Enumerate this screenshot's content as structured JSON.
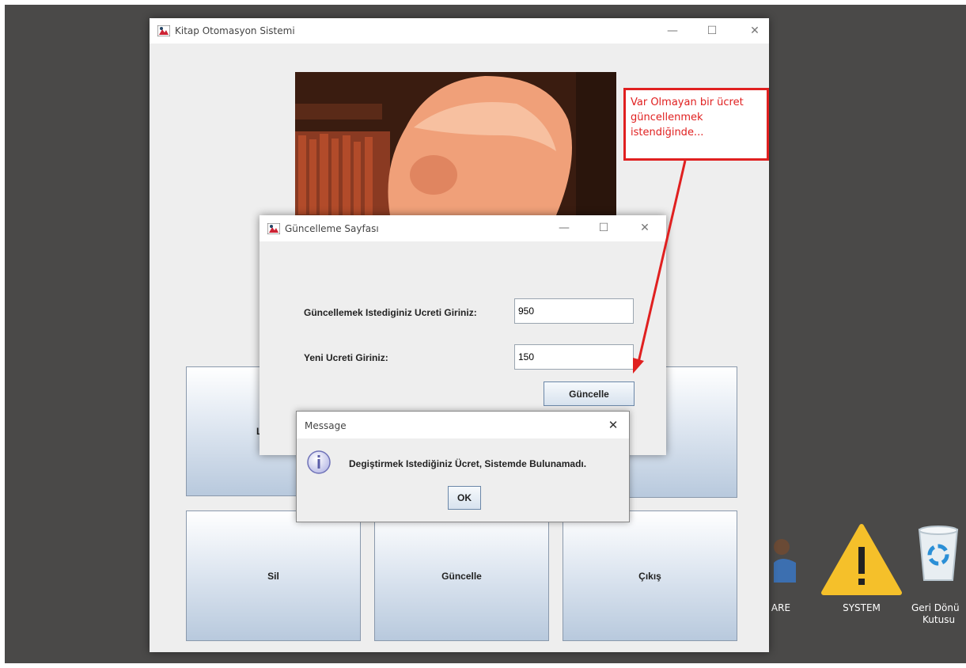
{
  "main_window": {
    "title": "Kitap Otomasyon Sistemi",
    "buttons": {
      "sil": "Sil",
      "guncelle": "Güncelle",
      "cikis": "Çıkış",
      "hidden_left_partial": "L"
    }
  },
  "update_dialog": {
    "title": "Güncelleme Sayfası",
    "old_price_label": "Güncellemek Istediginiz Ucreti Giriniz:",
    "old_price_value": "950",
    "new_price_label": "Yeni Ucreti Giriniz:",
    "new_price_value": "150",
    "submit_label": "Güncelle"
  },
  "message_dialog": {
    "title": "Message",
    "text": "Degiştirmek Istediğiniz Ücret, Sistemde Bulunamadı.",
    "ok_label": "OK",
    "icon": "info-icon"
  },
  "annotation": {
    "text_lines": [
      "Var Olmayan bir ücret",
      "güncellenmek",
      "istendiğinde..."
    ],
    "color": "#e02020"
  },
  "desktop_icons": [
    {
      "label": "ARE",
      "icon": "user-icon"
    },
    {
      "label": "SYSTEM",
      "icon": "warning-icon"
    },
    {
      "label_line1": "Geri Dönü",
      "label_line2": "Kutusu",
      "icon": "recycle-bin-icon"
    }
  ],
  "window_controls": {
    "minimize": "—",
    "maximize": "☐",
    "close": "✕"
  }
}
